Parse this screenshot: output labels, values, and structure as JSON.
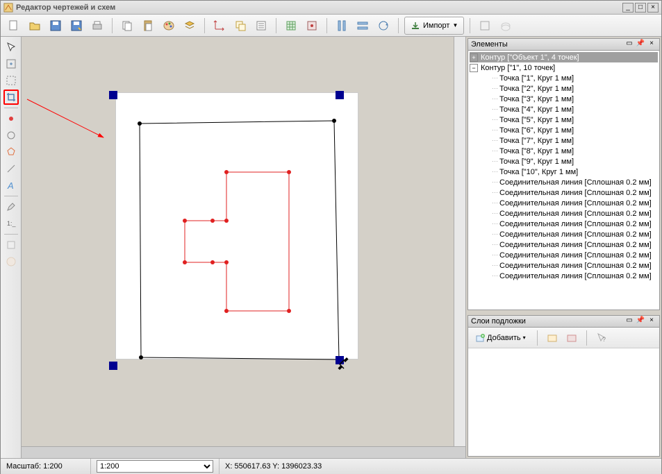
{
  "title": "Редактор чертежей и схем",
  "toolbar": {
    "import_label": "Импорт"
  },
  "panels": {
    "elements_title": "Элементы",
    "layers_title": "Слои подложки",
    "add_label": "Добавить"
  },
  "tree": {
    "root1": "Контур [\"Объект 1\", 4 точек]",
    "root2": "Контур [\"1\", 10 точек]",
    "points": [
      "Точка [\"1\", Круг 1 мм]",
      "Точка [\"2\", Круг 1 мм]",
      "Точка [\"3\", Круг 1 мм]",
      "Точка [\"4\", Круг 1 мм]",
      "Точка [\"5\", Круг 1 мм]",
      "Точка [\"6\", Круг 1 мм]",
      "Точка [\"7\", Круг 1 мм]",
      "Точка [\"8\", Круг 1 мм]",
      "Точка [\"9\", Круг 1 мм]",
      "Точка [\"10\", Круг 1 мм]"
    ],
    "lines": [
      "Соединительная линия [Сплошная 0.2 мм]",
      "Соединительная линия [Сплошная 0.2 мм]",
      "Соединительная линия [Сплошная 0.2 мм]",
      "Соединительная линия [Сплошная 0.2 мм]",
      "Соединительная линия [Сплошная 0.2 мм]",
      "Соединительная линия [Сплошная 0.2 мм]",
      "Соединительная линия [Сплошная 0.2 мм]",
      "Соединительная линия [Сплошная 0.2 мм]",
      "Соединительная линия [Сплошная 0.2 мм]",
      "Соединительная линия [Сплошная 0.2 мм]"
    ]
  },
  "status": {
    "scale_label": "Масштаб: 1:200",
    "scale_value": "1:200",
    "coords": "X: 550617.63 Y: 1396023.33"
  }
}
